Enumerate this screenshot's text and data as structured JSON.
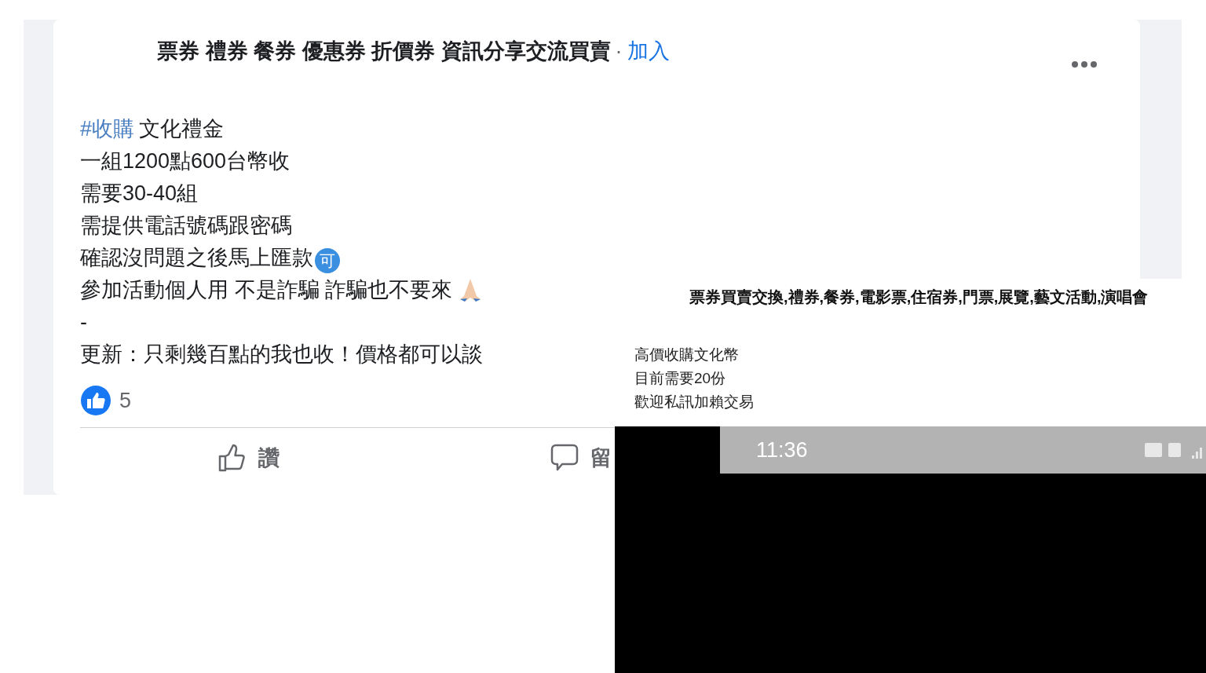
{
  "post": {
    "group_name": "票券 禮券 餐券 優惠券 折價券 資訊分享交流買賣",
    "separator": "·",
    "join_link": "加入",
    "body": [
      {
        "hashtag": "#收購",
        "text": "文化禮金"
      },
      {
        "text": "一組1200點600台幣收"
      },
      {
        "text": "需要30-40組"
      },
      {
        "text": "需提供電話號碼跟密碼"
      },
      {
        "text": "確認沒問題之後馬上匯款",
        "badge": "可"
      },
      {
        "text": "參加活動個人用 不是詐騙 詐騙也不要來",
        "praying_hands": true
      },
      {
        "text": "-"
      },
      {
        "text": "更新：只剩幾百點的我也收！價格都可以談"
      }
    ],
    "reaction_count": "5",
    "actions": [
      {
        "kind": "like",
        "label": "讚"
      },
      {
        "kind": "comment",
        "label": "留"
      }
    ]
  },
  "overlay": {
    "title": "票券買賣交換,禮券,餐券,電影票,住宿券,門票,展覽,藝文活動,演唱會",
    "lines": [
      "高價收購文化幣",
      "目前需要20份",
      "歡迎私訊加賴交易"
    ],
    "phone_status": {
      "time": "11:36"
    }
  }
}
